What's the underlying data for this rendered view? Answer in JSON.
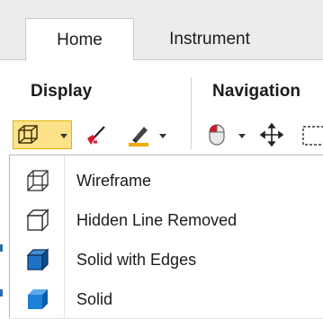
{
  "tabs": [
    {
      "label": "Home",
      "active": true
    },
    {
      "label": "Instrument",
      "active": false
    }
  ],
  "groups": {
    "display_label": "Display",
    "navigation_label": "Navigation"
  },
  "toolbar": {
    "display_mode_icon": "wireframe-cube-icon",
    "paint_icon": "paint-brush-icon",
    "highlight_icon": "highlighter-icon",
    "mouse_icon": "mouse-icon",
    "pan_icon": "pan-arrows-icon",
    "select_icon": "select-box-icon"
  },
  "menu": {
    "items": [
      {
        "label": "Wireframe",
        "icon": "wireframe-cube-icon"
      },
      {
        "label": "Hidden Line Removed",
        "icon": "hidden-line-cube-icon"
      },
      {
        "label": "Solid with Edges",
        "icon": "solid-edges-cube-icon"
      },
      {
        "label": "Solid",
        "icon": "solid-cube-icon"
      }
    ]
  },
  "colors": {
    "accent_pressed": "#fde28a",
    "solid_blue": "#1e73c8",
    "solid_blue_dark": "#0b4d8f"
  }
}
